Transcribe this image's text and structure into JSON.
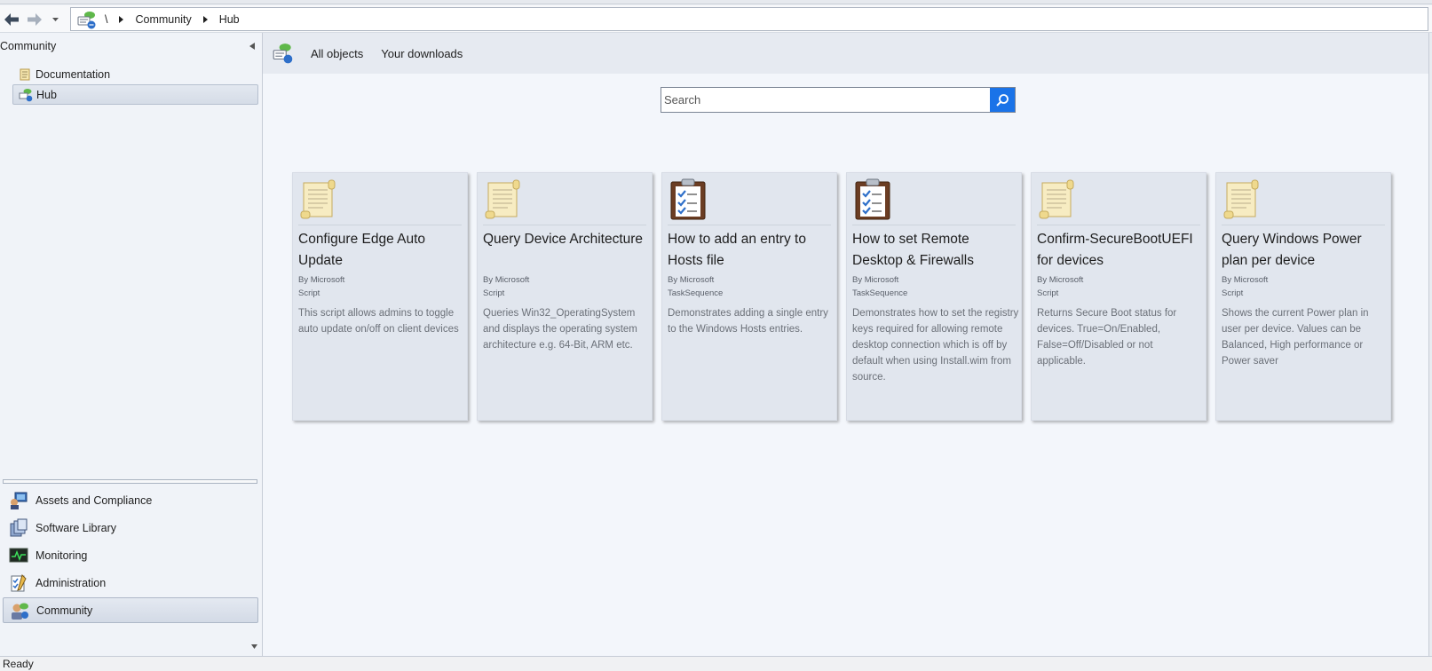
{
  "breadcrumb": {
    "root": "\\",
    "items": [
      "Community",
      "Hub"
    ]
  },
  "leftpane": {
    "title": "Community",
    "tree": [
      {
        "label": "Documentation",
        "icon": "scroll-icon"
      },
      {
        "label": "Hub",
        "icon": "hub-icon",
        "selected": true
      }
    ],
    "workspaces": [
      {
        "label": "Assets and Compliance",
        "icon": "assets-icon"
      },
      {
        "label": "Software Library",
        "icon": "library-icon"
      },
      {
        "label": "Monitoring",
        "icon": "monitoring-icon"
      },
      {
        "label": "Administration",
        "icon": "administration-icon"
      },
      {
        "label": "Community",
        "icon": "community-icon",
        "selected": true
      }
    ]
  },
  "toolbar": {
    "links": [
      "All objects",
      "Your downloads"
    ]
  },
  "search": {
    "placeholder": "Search"
  },
  "cards": [
    {
      "title": "Configure Edge Auto Update",
      "by": "By Microsoft",
      "kind": "Script",
      "icon": "scroll-icon",
      "description": "This script allows admins to toggle auto update on/off on client devices"
    },
    {
      "title": "Query Device Architecture",
      "by": "By Microsoft",
      "kind": "Script",
      "icon": "scroll-icon",
      "description": "Queries Win32_OperatingSystem and displays the operating system architecture e.g. 64-Bit, ARM etc."
    },
    {
      "title": "How to add an entry to Hosts file",
      "by": "By Microsoft",
      "kind": "TaskSequence",
      "icon": "clipboard-checklist-icon",
      "description": "Demonstrates adding a single entry to the Windows Hosts entries."
    },
    {
      "title": "How to set Remote Desktop & Firewalls",
      "by": "By Microsoft",
      "kind": "TaskSequence",
      "icon": "clipboard-checklist-icon",
      "description": "Demonstrates how to set the registry keys required for allowing remote desktop connection which is off by default when using Install.wim from source."
    },
    {
      "title": "Confirm-SecureBootUEFI for devices",
      "by": "By Microsoft",
      "kind": "Script",
      "icon": "scroll-icon",
      "description": "Returns Secure Boot status for devices. True=On/Enabled, False=Off/Disabled or not applicable."
    },
    {
      "title": "Query Windows Power plan per device",
      "by": "By Microsoft",
      "kind": "Script",
      "icon": "scroll-icon",
      "description": "Shows the current Power plan in user per device. Values can be Balanced, High performance or Power saver"
    }
  ],
  "status": "Ready",
  "colors": {
    "accent": "#1a73e8",
    "card_bg": "#e1e6ee",
    "pane_bg": "#f0f3f8"
  }
}
